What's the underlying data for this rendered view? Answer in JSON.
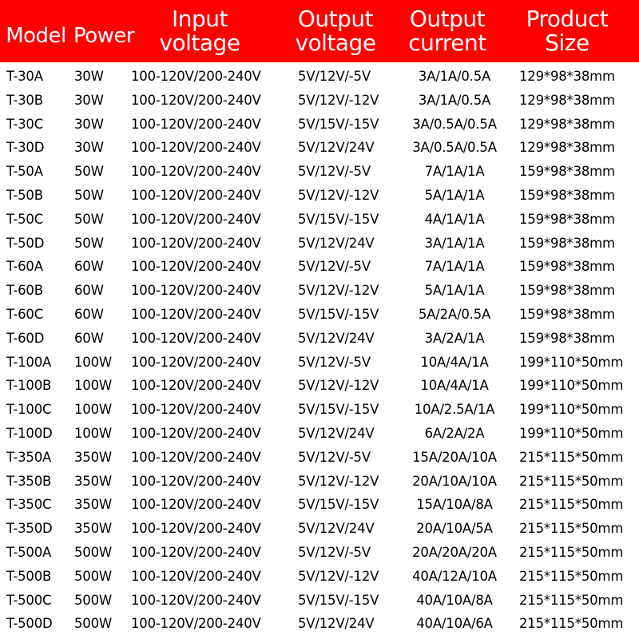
{
  "header": {
    "model": "Model",
    "power": "Power",
    "input_voltage": [
      "Input",
      "voltage"
    ],
    "output_voltage": [
      "Output",
      "voltage"
    ],
    "output_current": [
      "Output",
      "current"
    ],
    "product_size": [
      "Product",
      "Size"
    ],
    "background_color": "#fe0000",
    "text_color": "#ffffff"
  },
  "rows": [
    {
      "model": "T-30A",
      "power": "30W",
      "input": "100-120V/200-240V",
      "output_voltage": "5V/12V/-5V",
      "output_current": "3A/1A/0.5A",
      "size": "129*98*38mm"
    },
    {
      "model": "T-30B",
      "power": "30W",
      "input": "100-120V/200-240V",
      "output_voltage": "5V/12V/-12V",
      "output_current": "3A/1A/0.5A",
      "size": "129*98*38mm"
    },
    {
      "model": "T-30C",
      "power": "30W",
      "input": "100-120V/200-240V",
      "output_voltage": "5V/15V/-15V",
      "output_current": "3A/0.5A/0.5A",
      "size": "129*98*38mm"
    },
    {
      "model": "T-30D",
      "power": "30W",
      "input": "100-120V/200-240V",
      "output_voltage": "5V/12V/24V",
      "output_current": "3A/0.5A/0.5A",
      "size": "129*98*38mm"
    },
    {
      "model": "T-50A",
      "power": "50W",
      "input": "100-120V/200-240V",
      "output_voltage": "5V/12V/-5V",
      "output_current": "7A/1A/1A",
      "size": "159*98*38mm"
    },
    {
      "model": "T-50B",
      "power": "50W",
      "input": "100-120V/200-240V",
      "output_voltage": "5V/12V/-12V",
      "output_current": "5A/1A/1A",
      "size": "159*98*38mm"
    },
    {
      "model": "T-50C",
      "power": "50W",
      "input": "100-120V/200-240V",
      "output_voltage": "5V/15V/-15V",
      "output_current": "4A/1A/1A",
      "size": "159*98*38mm"
    },
    {
      "model": "T-50D",
      "power": "50W",
      "input": "100-120V/200-240V",
      "output_voltage": "5V/12V/24V",
      "output_current": "3A/1A/1A",
      "size": "159*98*38mm"
    },
    {
      "model": "T-60A",
      "power": "60W",
      "input": "100-120V/200-240V",
      "output_voltage": "5V/12V/-5V",
      "output_current": "7A/1A/1A",
      "size": "159*98*38mm"
    },
    {
      "model": "T-60B",
      "power": "60W",
      "input": "100-120V/200-240V",
      "output_voltage": "5V/12V/-12V",
      "output_current": "5A/1A/1A",
      "size": "159*98*38mm"
    },
    {
      "model": "T-60C",
      "power": "60W",
      "input": "100-120V/200-240V",
      "output_voltage": "5V/15V/-15V",
      "output_current": "5A/2A/0.5A",
      "size": "159*98*38mm"
    },
    {
      "model": "T-60D",
      "power": "60W",
      "input": "100-120V/200-240V",
      "output_voltage": "5V/12V/24V",
      "output_current": "3A/2A/1A",
      "size": "159*98*38mm"
    },
    {
      "model": "T-100A",
      "power": "100W",
      "input": "100-120V/200-240V",
      "output_voltage": "5V/12V/-5V",
      "output_current": "10A/4A/1A",
      "size": "199*110*50mm"
    },
    {
      "model": "T-100B",
      "power": "100W",
      "input": "100-120V/200-240V",
      "output_voltage": "5V/12V/-12V",
      "output_current": "10A/4A/1A",
      "size": "199*110*50mm"
    },
    {
      "model": "T-100C",
      "power": "100W",
      "input": "100-120V/200-240V",
      "output_voltage": "5V/15V/-15V",
      "output_current": "10A/2.5A/1A",
      "size": "199*110*50mm"
    },
    {
      "model": "T-100D",
      "power": "100W",
      "input": "100-120V/200-240V",
      "output_voltage": "5V/12V/24V",
      "output_current": "6A/2A/2A",
      "size": "199*110*50mm"
    },
    {
      "model": "T-350A",
      "power": "350W",
      "input": "100-120V/200-240V",
      "output_voltage": "5V/12V/-5V",
      "output_current": "15A/20A/10A",
      "size": "215*115*50mm"
    },
    {
      "model": "T-350B",
      "power": "350W",
      "input": "100-120V/200-240V",
      "output_voltage": "5V/12V/-12V",
      "output_current": "20A/10A/10A",
      "size": "215*115*50mm"
    },
    {
      "model": "T-350C",
      "power": "350W",
      "input": "100-120V/200-240V",
      "output_voltage": "5V/15V/-15V",
      "output_current": "15A/10A/8A",
      "size": "215*115*50mm"
    },
    {
      "model": "T-350D",
      "power": "350W",
      "input": "100-120V/200-240V",
      "output_voltage": "5V/12V/24V",
      "output_current": "20A/10A/5A",
      "size": "215*115*50mm"
    },
    {
      "model": "T-500A",
      "power": "500W",
      "input": "100-120V/200-240V",
      "output_voltage": "5V/12V/-5V",
      "output_current": "20A/20A/20A",
      "size": "215*115*50mm"
    },
    {
      "model": "T-500B",
      "power": "500W",
      "input": "100-120V/200-240V",
      "output_voltage": "5V/12V/-12V",
      "output_current": "40A/12A/10A",
      "size": "215*115*50mm"
    },
    {
      "model": "T-500C",
      "power": "500W",
      "input": "100-120V/200-240V",
      "output_voltage": "5V/15V/-15V",
      "output_current": "40A/10A/8A",
      "size": "215*115*50mm"
    },
    {
      "model": "T-500D",
      "power": "500W",
      "input": "100-120V/200-240V",
      "output_voltage": "5V/12V/24V",
      "output_current": "40A/10A/6A",
      "size": "215*115*50mm"
    }
  ]
}
